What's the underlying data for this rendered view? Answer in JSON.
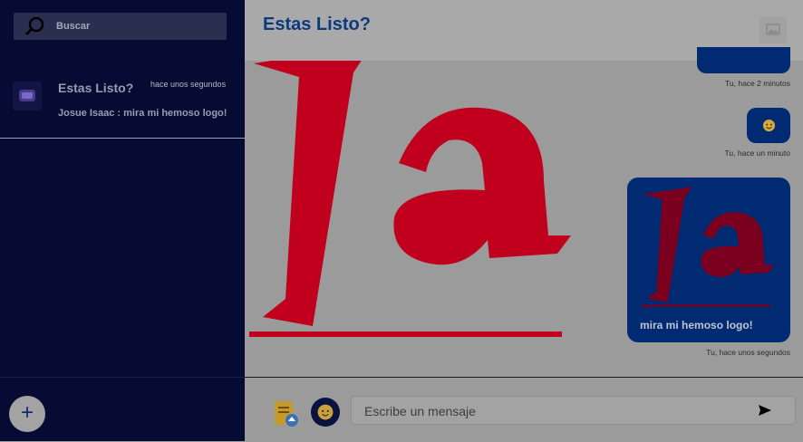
{
  "sidebar": {
    "search": {
      "placeholder": "Buscar"
    },
    "conversations": [
      {
        "name": "Estas Listo?",
        "time": "hace unos segundos",
        "preview": "Josue Isaac : mira mi hemoso logo!"
      }
    ],
    "add_button": "+"
  },
  "chat": {
    "title": "Estas Listo?",
    "messages": [
      {
        "meta": "Tu, hace 2 minutos"
      },
      {
        "meta": "Tu, hace un minuto"
      },
      {
        "caption": "mira mi hemoso logo!",
        "meta": "Tu, hace unos segundos"
      }
    ],
    "composer": {
      "placeholder": "Escribe un mensaje"
    }
  },
  "colors": {
    "sidebar": "#070b33",
    "bubble": "#002b73",
    "logo_red": "#c1001e",
    "title": "#0d3a7e"
  },
  "icons": [
    "search-icon",
    "image-icon",
    "attach-file-icon",
    "emoji-icon",
    "send-icon",
    "plus-icon"
  ]
}
